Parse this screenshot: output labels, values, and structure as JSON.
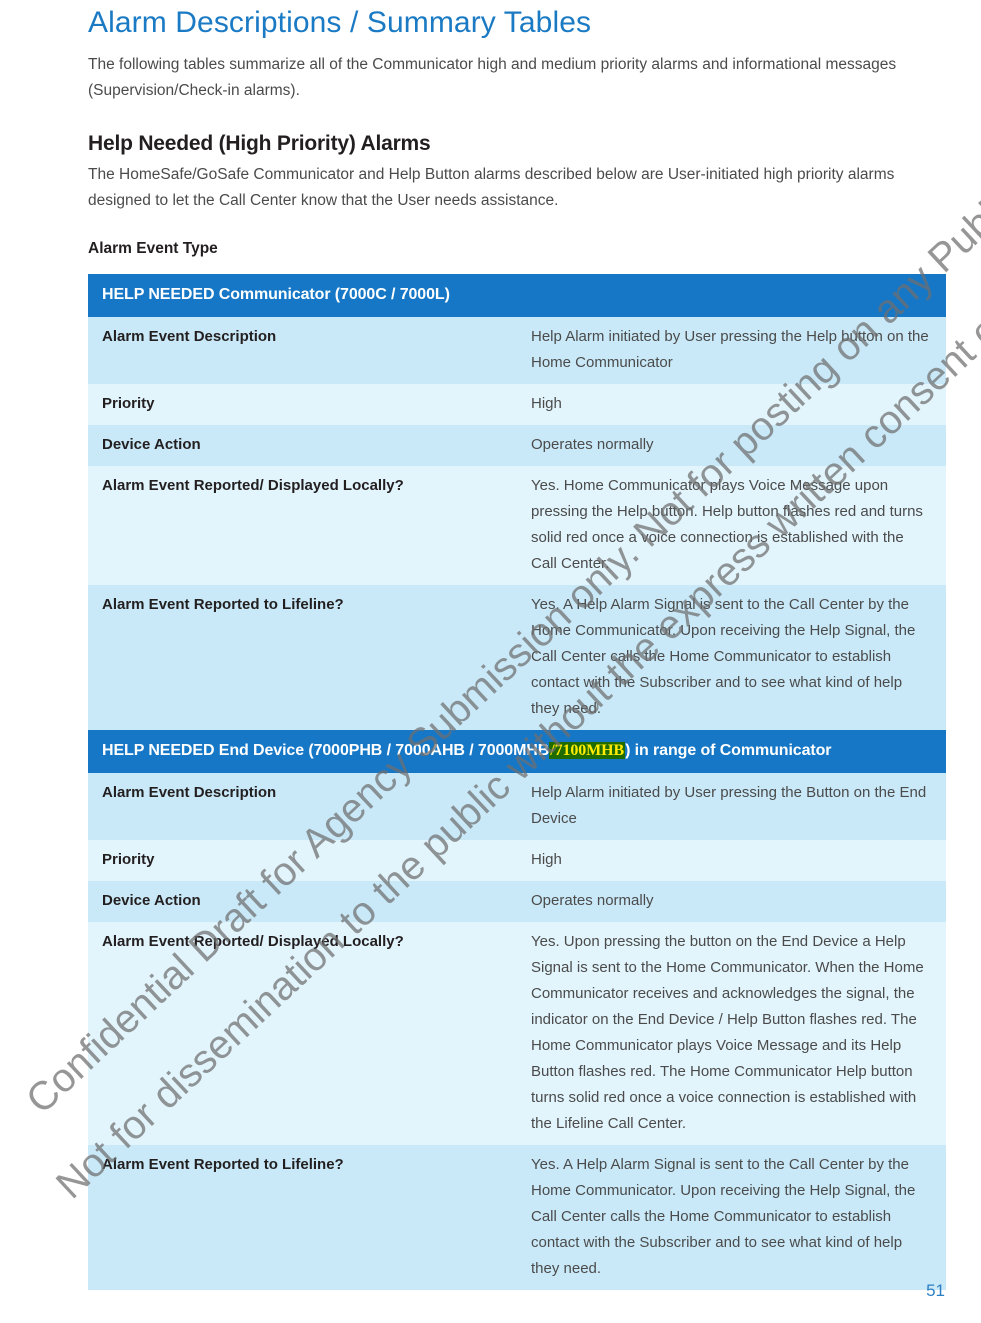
{
  "document": {
    "title": "Alarm Descriptions / Summary Tables",
    "intro": "The following tables summarize all of the Communicator high and medium priority alarms and informational messages (Supervision/Check-in alarms).",
    "section_heading": "Help Needed (High Priority) Alarms",
    "section_body": "The HomeSafe/GoSafe Communicator and Help Button alarms described below are User-initiated high priority alarms designed to let the Call Center know that the User needs assistance.",
    "sub_heading": "Alarm Event Type",
    "page_number": "51"
  },
  "watermark": {
    "line1": "Confidential Draft for Agency Submission only. Not for posting on any Public-Facing website",
    "line2": "Not for dissemination to the public without the express written consent of Philips."
  },
  "colors": {
    "title_blue": "#1b7ac4",
    "table_header_blue": "#1577c6",
    "row_shade_a": "#c9e9f8",
    "row_shade_b": "#e2f4fc",
    "highlight_background": "#1f6b00",
    "highlight_text": "#ffec00",
    "body_text": "#4b4b4b",
    "label_text": "#231f20",
    "page_number_blue": "#2a7fc4"
  },
  "tables": [
    {
      "header": "HELP NEEDED Communicator (7000C / 7000L)",
      "rows": [
        {
          "label": "Alarm Event Description",
          "value": "Help Alarm initiated by User pressing the Help button on the Home Communicator"
        },
        {
          "label": "Priority",
          "value": "High"
        },
        {
          "label": "Device Action",
          "value": "Operates normally"
        },
        {
          "label": "Alarm Event Reported/ Displayed Locally?",
          "value": "Yes. Home Communicator plays Voice Message upon pressing the Help button. Help button flashes red and turns solid red once a voice connection is established with the Call Center."
        },
        {
          "label": "Alarm Event Reported to Lifeline?",
          "value": "Yes. A Help Alarm Signal is sent to the Call Center by the Home Communicator. Upon receiving the Help Signal, the Call Center calls the Home Communicator to establish contact with the Subscriber and to see what kind of help they need."
        }
      ]
    },
    {
      "header_pre": "HELP NEEDED End Device (7000PHB / 7000AHB / 7000MHB",
      "header_highlight": "/7100MHB",
      "header_post": ") in range of Communicator",
      "rows": [
        {
          "label": "Alarm Event Description",
          "value": "Help Alarm initiated by User pressing the Button on the End Device"
        },
        {
          "label": "Priority",
          "value": "High"
        },
        {
          "label": "Device Action",
          "value": "Operates normally"
        },
        {
          "label": "Alarm Event Reported/ Displayed Locally?",
          "value": "Yes. Upon pressing the button on the End Device a Help Signal is sent to the Home Communicator. When the Home Communicator receives and acknowledges the signal, the indicator on the End Device / Help Button flashes red. The Home Communicator plays Voice Message and its Help Button flashes red. The Home Communicator Help button turns solid red once a voice connection is established with the Lifeline Call Center."
        },
        {
          "label": "Alarm Event Reported to Lifeline?",
          "value": "Yes. A Help Alarm Signal is sent to the Call Center by the Home Communicator. Upon receiving the Help Signal, the Call Center calls the Home Communicator to establish contact with the Subscriber and to see what kind of help they need."
        }
      ]
    }
  ]
}
